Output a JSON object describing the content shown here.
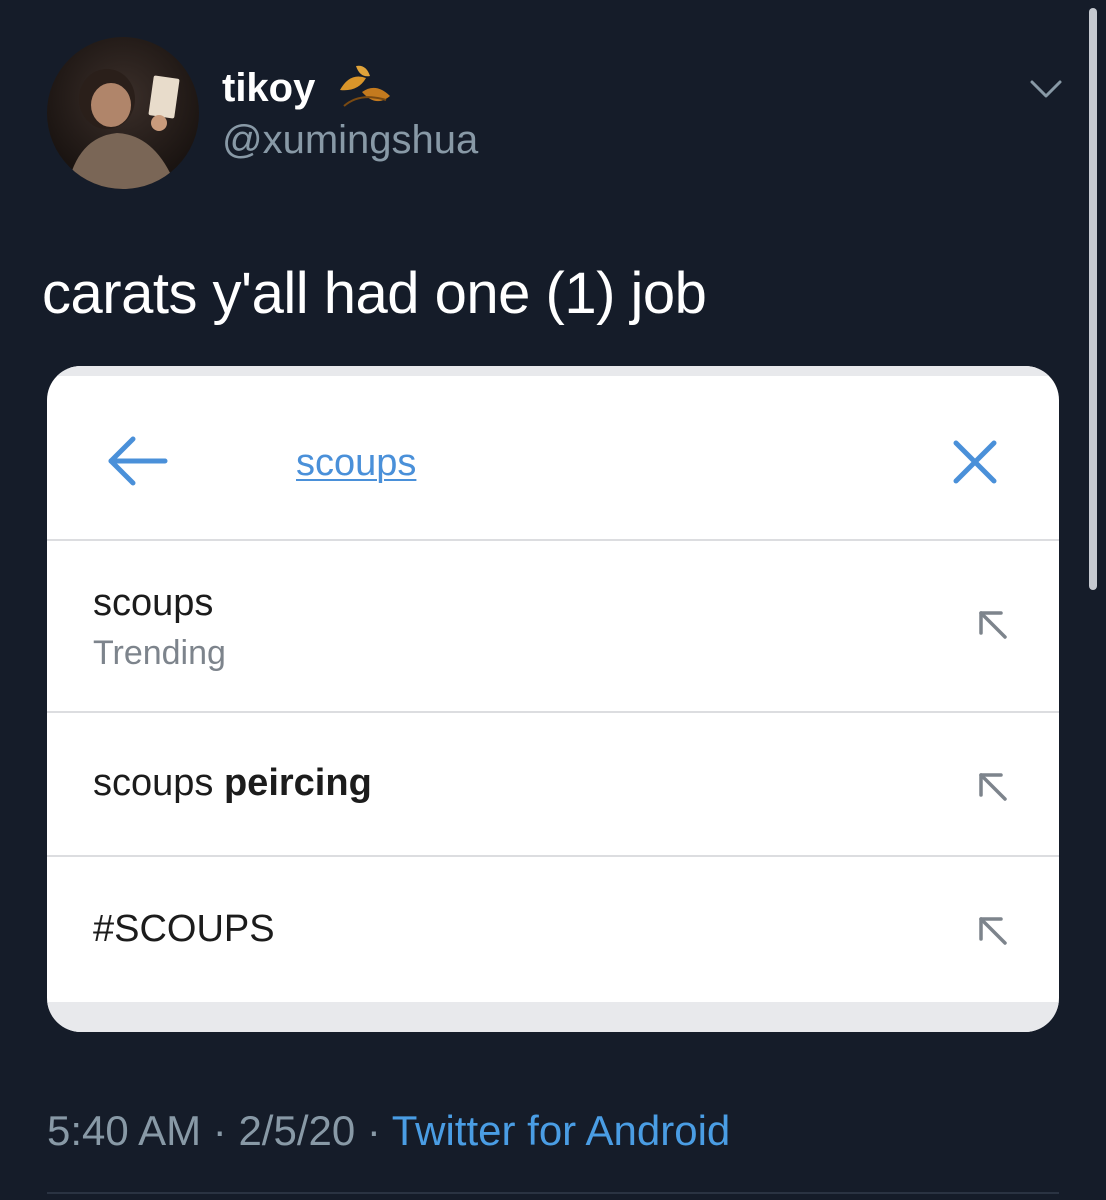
{
  "author": {
    "display_name": "tikoy",
    "handle": "@xumingshua",
    "name_emoji_icon": "fallen-leaf-icon"
  },
  "tweet": {
    "text": "carats y'all had one (1) job"
  },
  "screenshot": {
    "search_query": "scoups",
    "suggestions": [
      {
        "prefix": "scoups",
        "bold_suffix": "",
        "subtitle": "Trending"
      },
      {
        "prefix": "scoups ",
        "bold_suffix": "peircing",
        "subtitle": ""
      },
      {
        "prefix": "#SCOUPS",
        "bold_suffix": "",
        "subtitle": ""
      }
    ]
  },
  "meta": {
    "time": "5:40 AM",
    "separator": " · ",
    "date": "2/5/20",
    "source": "Twitter for Android"
  },
  "colors": {
    "background": "#151c29",
    "link_blue": "#4a9de4",
    "muted_text": "#8899a6",
    "card_accent": "#4a90d9"
  }
}
